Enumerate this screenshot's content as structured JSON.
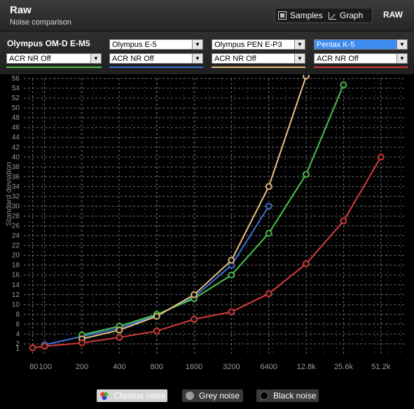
{
  "header": {
    "title": "Raw",
    "subtitle": "Noise comparison",
    "view_samples": "Samples",
    "view_graph": "Graph",
    "format": "RAW"
  },
  "cameras": [
    {
      "name": "Olympus OM-D E-M5",
      "setting": "ACR NR Off",
      "color": "#4cc24c",
      "static": true
    },
    {
      "name": "Olympus E-5",
      "setting": "ACR NR Off",
      "color": "#3a6fd8",
      "static": false
    },
    {
      "name": "Olympus PEN E-P3",
      "setting": "ACR NR Off",
      "color": "#e8c080",
      "static": false
    },
    {
      "name": "Pentax K-5",
      "setting": "ACR NR Off",
      "color": "#d83a3a",
      "static": false,
      "active": true
    }
  ],
  "legend": {
    "chroma": "Chroma noise",
    "grey": "Grey noise",
    "black": "Black noise"
  },
  "chart_data": {
    "type": "line",
    "ylabel": "Standard deviation",
    "x_ticks": [
      "80",
      "100",
      "200",
      "400",
      "800",
      "1600",
      "3200",
      "6400",
      "12.8k",
      "25.6k",
      "51.2k"
    ],
    "x_scale": "log2 ISO",
    "ylim": [
      0,
      56
    ],
    "y_ticks": [
      1,
      2,
      4,
      6,
      8,
      10,
      12,
      14,
      16,
      18,
      20,
      22,
      24,
      26,
      28,
      30,
      32,
      34,
      36,
      38,
      40,
      42,
      44,
      46,
      48,
      50,
      52,
      54,
      56
    ],
    "grid": true,
    "series": [
      {
        "name": "Olympus E-5",
        "color": "#3a6fd8",
        "points": [
          [
            100,
            1.8
          ],
          [
            200,
            3.5
          ],
          [
            400,
            5.2
          ],
          [
            800,
            7.8
          ],
          [
            1600,
            11.5
          ],
          [
            3200,
            18.0
          ],
          [
            6400,
            30.0
          ]
        ]
      },
      {
        "name": "Olympus OM-D E-M5",
        "color": "#4cc24c",
        "points": [
          [
            200,
            3.8
          ],
          [
            400,
            5.6
          ],
          [
            800,
            8.0
          ],
          [
            1600,
            11.2
          ],
          [
            3200,
            16.0
          ],
          [
            6400,
            24.5
          ],
          [
            12800,
            36.5
          ],
          [
            25600,
            54.7
          ]
        ]
      },
      {
        "name": "Olympus PEN E-P3",
        "color": "#e8c080",
        "points": [
          [
            200,
            3.0
          ],
          [
            400,
            4.8
          ],
          [
            800,
            7.6
          ],
          [
            1600,
            12.0
          ],
          [
            3200,
            19.0
          ],
          [
            6400,
            34.0
          ],
          [
            12800,
            56.5
          ]
        ]
      },
      {
        "name": "Pentax K-5",
        "color": "#d83a3a",
        "points": [
          [
            80,
            1.2
          ],
          [
            100,
            1.5
          ],
          [
            200,
            2.2
          ],
          [
            400,
            3.3
          ],
          [
            800,
            4.6
          ],
          [
            1600,
            7.0
          ],
          [
            3200,
            8.5
          ],
          [
            6400,
            12.2
          ],
          [
            12800,
            18.3
          ],
          [
            25600,
            27.0
          ],
          [
            51200,
            40.0
          ]
        ]
      }
    ]
  }
}
